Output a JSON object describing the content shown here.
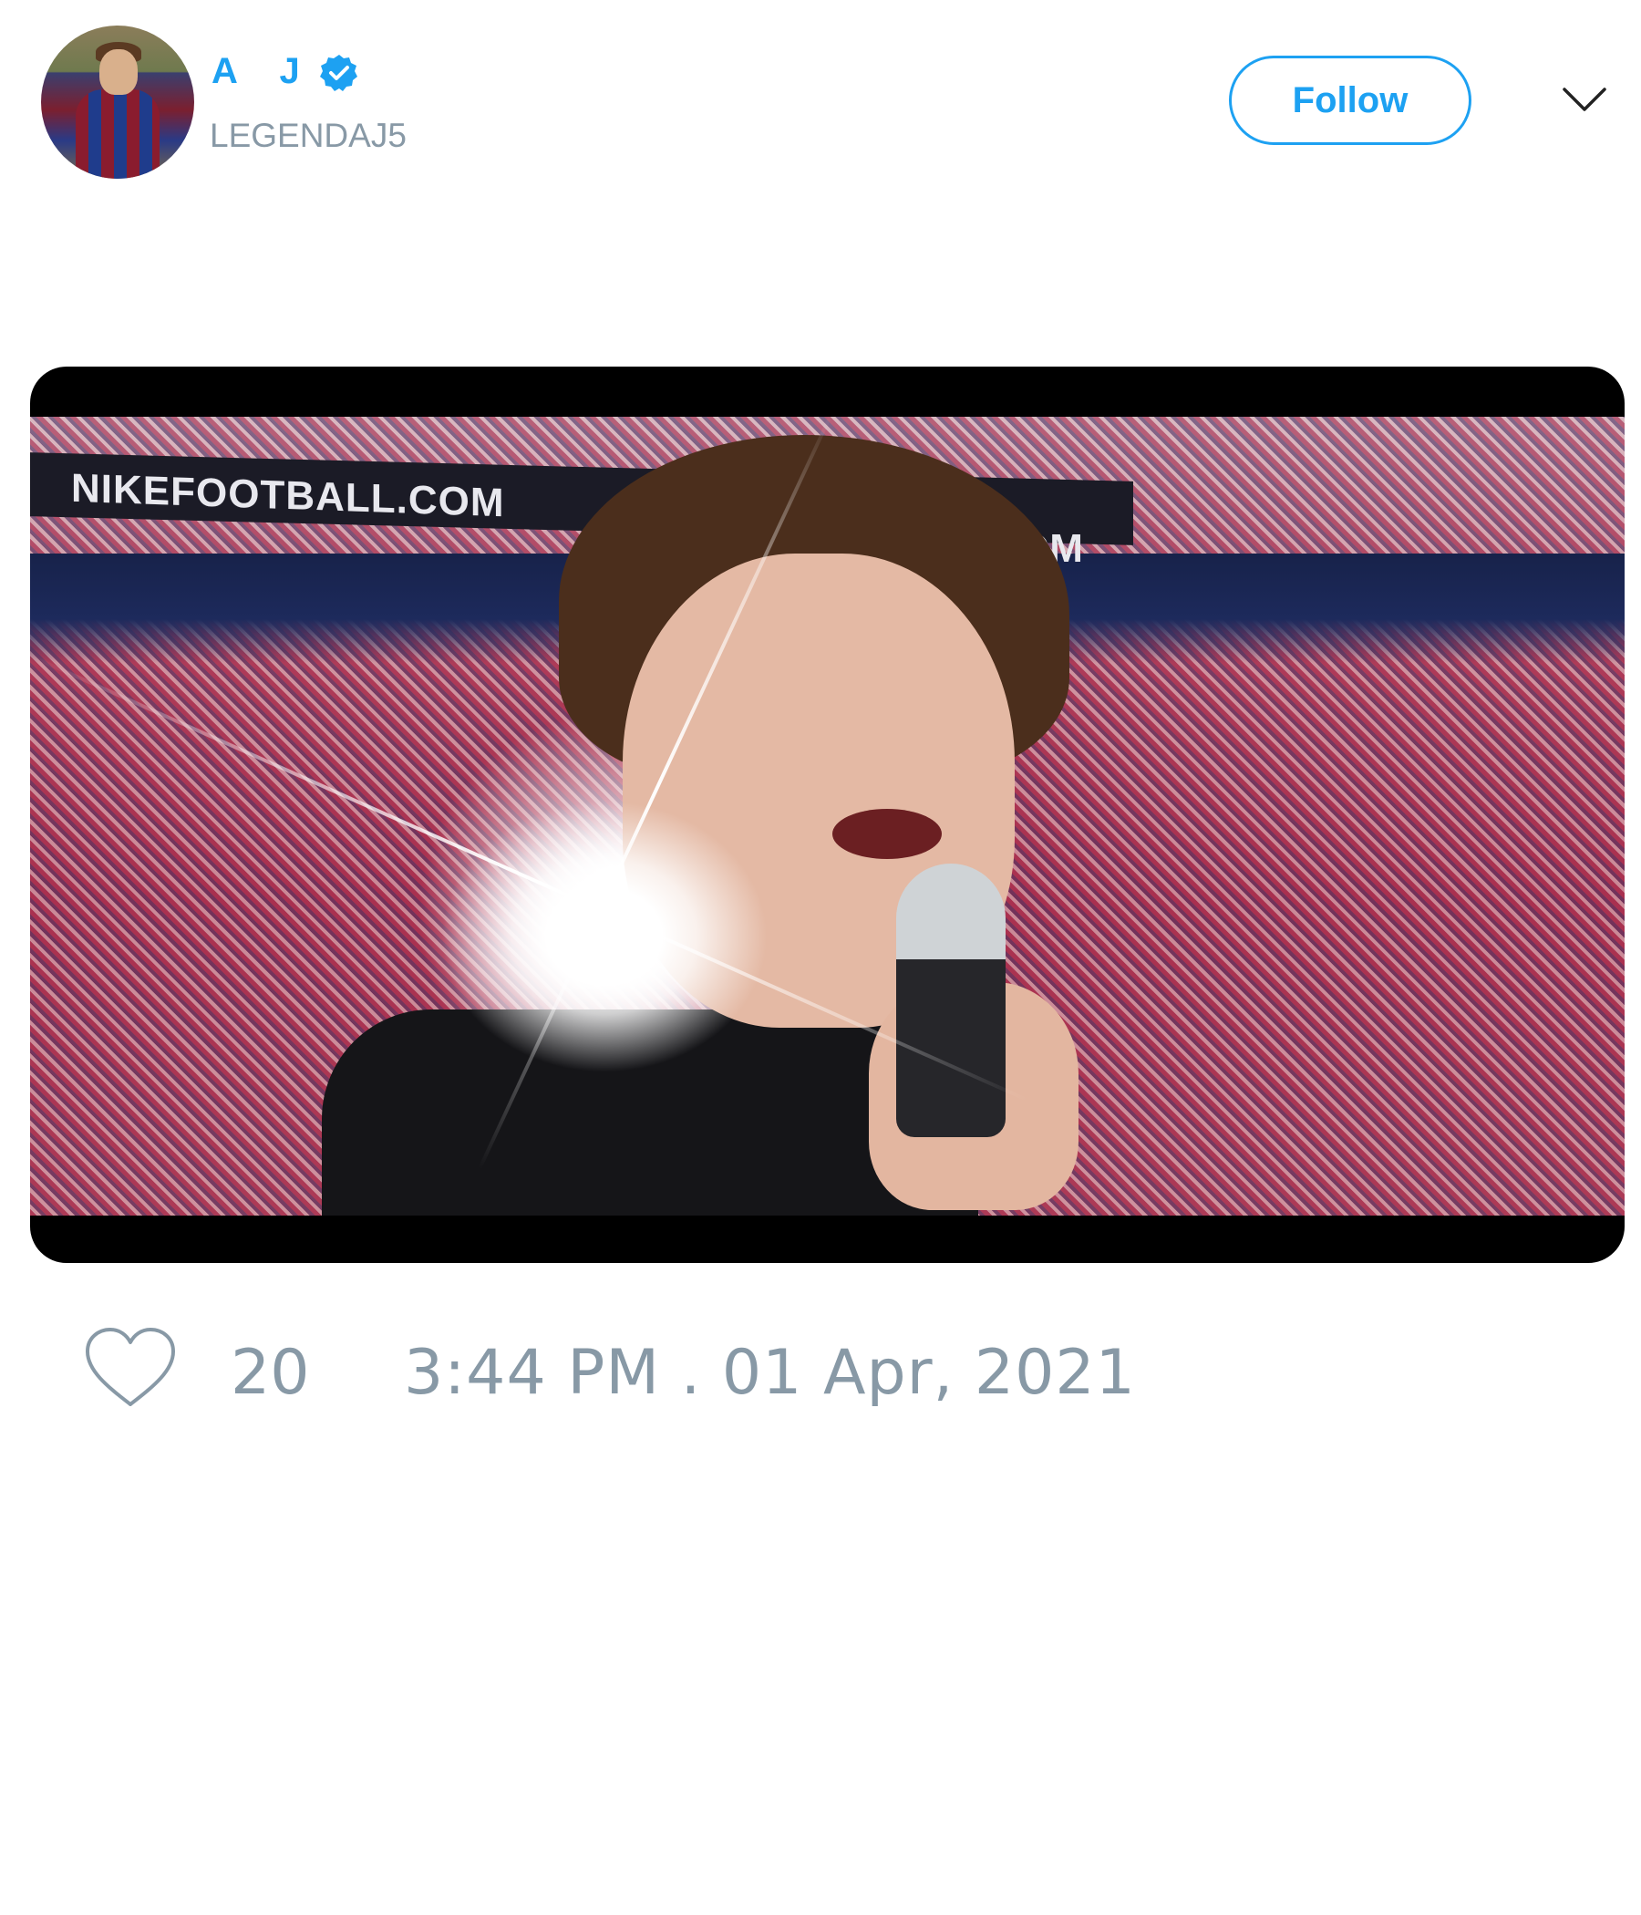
{
  "tweet": {
    "author": {
      "display_name": "A J",
      "handle": "LEGENDAJ5",
      "verified": true,
      "avatar_icon": "avatar-photo"
    },
    "follow_label": "Follow",
    "menu_icon": "chevron-down-icon",
    "media": {
      "type": "video",
      "banner_text_left": "NIKEFOOTBALL.COM",
      "banner_text_right": ".COM"
    },
    "like_icon": "heart-icon",
    "like_count": "20",
    "timestamp": "3:44 PM . 01 Apr, 2021"
  },
  "colors": {
    "accent": "#1da1f2",
    "secondary_text": "#8899a6"
  }
}
